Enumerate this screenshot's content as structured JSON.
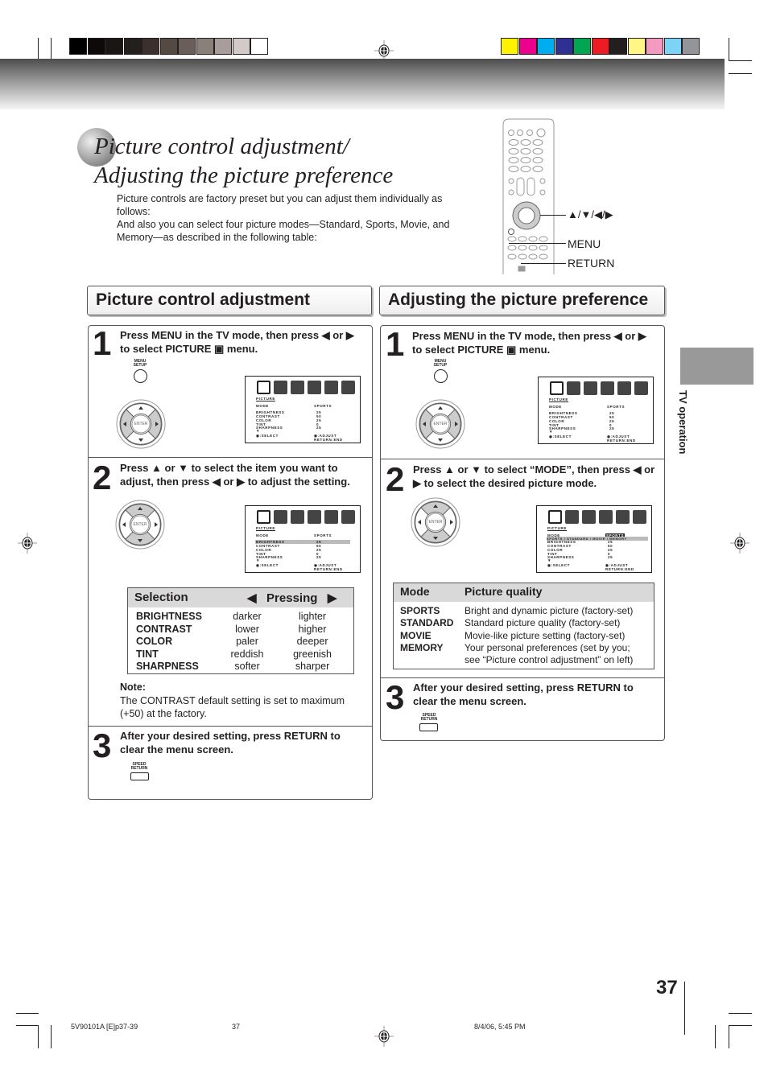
{
  "colors": {
    "grays": [
      "#000000",
      "#0d0a09",
      "#1a1614",
      "#231f1d",
      "#3b302d",
      "#554944",
      "#6a5e5a",
      "#8a7f7b",
      "#a89d9a",
      "#d3cac8",
      "#ffffff"
    ],
    "process": [
      "#fff200",
      "#ec008c",
      "#00aeef",
      "#2e3192",
      "#00a651",
      "#ed1c24",
      "#231f20",
      "#fff685",
      "#f49ac1",
      "#7dd3f5",
      "#939598"
    ]
  },
  "title": {
    "line1": "Picture control adjustment/",
    "line2": "Adjusting the picture preference"
  },
  "intro": {
    "p1": "Picture controls are factory preset but you can adjust them individually as follows:",
    "p2": "And also you can select four picture modes—Standard, Sports, Movie, and Memory—as described in the following table:"
  },
  "remote": {
    "arrows_label": "▲/▼/◀/▶",
    "menu_label": "MENU",
    "return_label": "RETURN"
  },
  "left": {
    "heading": "Picture control adjustment",
    "step1": {
      "num": "1",
      "text": "Press MENU in the TV mode, then press ◀ or ▶ to select PICTURE ▣ menu.",
      "button": "MENU SETUP"
    },
    "step2": {
      "num": "2",
      "text": "Press ▲ or ▼ to select the item you want to adjust, then press ◀ or ▶ to adjust the setting."
    },
    "table": {
      "col1": "Selection",
      "col2": "◀   Pressing   ▶",
      "rows": [
        [
          "BRIGHTNESS",
          "darker",
          "lighter"
        ],
        [
          "CONTRAST",
          "lower",
          "higher"
        ],
        [
          "COLOR",
          "paler",
          "deeper"
        ],
        [
          "TINT",
          "reddish",
          "greenish"
        ],
        [
          "SHARPNESS",
          "softer",
          "sharper"
        ]
      ]
    },
    "note": {
      "label": "Note:",
      "text": "The CONTRAST default setting is set to maximum (+50) at the factory."
    },
    "step3": {
      "num": "3",
      "text": "After your desired setting, press RETURN to clear the menu screen.",
      "button": "SPEED RETURN"
    }
  },
  "right": {
    "heading": "Adjusting the picture preference",
    "step1": {
      "num": "1",
      "text": "Press MENU in the TV mode, then press ◀ or ▶ to select PICTURE ▣ menu.",
      "button": "MENU SETUP"
    },
    "step2": {
      "num": "2",
      "text": "Press ▲ or ▼ to select “MODE”, then press ◀ or ▶ to select the desired picture mode."
    },
    "table": {
      "col1": "Mode",
      "col2": "Picture quality",
      "rows": [
        [
          "SPORTS",
          "Bright and dynamic picture (factory-set)"
        ],
        [
          "STANDARD",
          "Standard picture quality (factory-set)"
        ],
        [
          "MOVIE",
          "Movie-like picture setting (factory-set)"
        ],
        [
          "MEMORY",
          "Your personal preferences (set by you; see “Picture control adjustment” on left)"
        ]
      ]
    },
    "step3": {
      "num": "3",
      "text": "After your desired setting, press RETURN to clear the menu screen.",
      "button": "SPEED RETURN"
    }
  },
  "osd": {
    "menu": "PICTURE",
    "mode": "MODE",
    "mode_value": "SPORTS",
    "items": [
      "BRIGHTNESS",
      "CONTRAST",
      "COLOR",
      "TINT",
      "SHARPNESS"
    ],
    "values": [
      "25",
      "50",
      "25",
      "0",
      "25"
    ],
    "mode_options": "SPORTS / STANDARD / MOVIE / MEMORY",
    "select": "◉:SELECT",
    "adjust": "◉:ADJUST",
    "return_end": "RETURN:END",
    "dial_center": "ENTER"
  },
  "side_tab": "TV operation",
  "page_number": "37",
  "footer": {
    "code": "5V90101A [E]p37-39",
    "page": "37",
    "date": "8/4/06, 5:45 PM"
  }
}
